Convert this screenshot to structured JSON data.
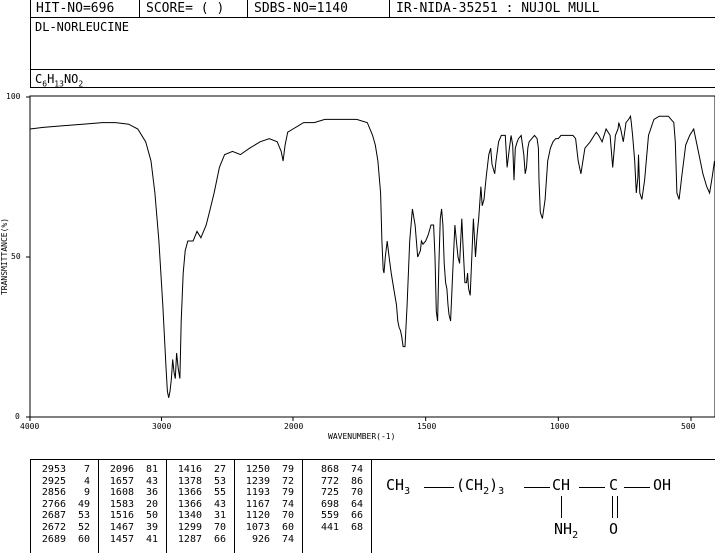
{
  "header": {
    "hit": "HIT-NO=696",
    "score": "SCORE=  (   )",
    "sdbs": "SDBS-NO=1140",
    "ir": "IR-NIDA-35251 : NUJOL MULL"
  },
  "compound": {
    "name": "DL-NORLEUCINE",
    "formula_parts": [
      "C",
      "6",
      "H",
      "13",
      "NO",
      "2"
    ]
  },
  "chart_data": {
    "type": "line",
    "title": "",
    "xlabel": "WAVENUMBER(-1)",
    "ylabel": "TRANSMITTANCE(%)",
    "xlim": [
      4000,
      400
    ],
    "ylim": [
      0,
      100
    ],
    "xticks": [
      "4000",
      "3000",
      "2000",
      "1500",
      "1000",
      "500"
    ],
    "yticks": [
      "100",
      "50",
      "0"
    ],
    "x_scale": "piecewise: 4000-2000 compressed, 2000-400 expanded",
    "series": [
      {
        "x": [
          4000,
          3900,
          3750,
          3600,
          3450,
          3350,
          3250,
          3180,
          3120,
          3080,
          3050,
          3020,
          2990,
          2965,
          2955,
          2945,
          2935,
          2925,
          2915,
          2905,
          2895,
          2885,
          2872,
          2860,
          2850,
          2835,
          2820,
          2800,
          2760,
          2730,
          2700,
          2660,
          2630,
          2600,
          2560,
          2520,
          2460,
          2400,
          2330,
          2250,
          2180,
          2120,
          2090,
          2075,
          2060,
          2040,
          2000,
          1960,
          1920,
          1880,
          1840,
          1800,
          1760,
          1720,
          1700,
          1690,
          1680,
          1670,
          1665,
          1660,
          1657,
          1652,
          1645,
          1638,
          1630,
          1620,
          1610,
          1605,
          1600,
          1595,
          1590,
          1585,
          1578,
          1570,
          1560,
          1550,
          1540,
          1530,
          1520,
          1516,
          1510,
          1500,
          1490,
          1480,
          1470,
          1465,
          1460,
          1455,
          1450,
          1445,
          1440,
          1435,
          1430,
          1425,
          1420,
          1416,
          1412,
          1406,
          1398,
          1390,
          1384,
          1378,
          1372,
          1368,
          1364,
          1360,
          1352,
          1346,
          1342,
          1340,
          1338,
          1332,
          1326,
          1320,
          1312,
          1306,
          1300,
          1292,
          1287,
          1280,
          1272,
          1262,
          1255,
          1250,
          1240,
          1235,
          1225,
          1215,
          1200,
          1193,
          1186,
          1178,
          1172,
          1167,
          1162,
          1155,
          1150,
          1140,
          1130,
          1125,
          1120,
          1115,
          1110,
          1100,
          1090,
          1080,
          1075,
          1073,
          1068,
          1060,
          1050,
          1040,
          1030,
          1020,
          1010,
          1000,
          990,
          980,
          970,
          960,
          945,
          935,
          925,
          915,
          900,
          880,
          865,
          857,
          848,
          835,
          820,
          805,
          795,
          785,
          775,
          772,
          765,
          755,
          745,
          735,
          728,
          725,
          720,
          712,
          706,
          700,
          698,
          693,
          685,
          675,
          660,
          640,
          620,
          600,
          585,
          575,
          565,
          559,
          553,
          545,
          535,
          520,
          505,
          490,
          470,
          455,
          441,
          430,
          420,
          400
        ],
        "y": [
          90,
          90.5,
          91,
          91.5,
          92,
          92,
          91.5,
          90,
          86,
          80,
          70,
          55,
          35,
          15,
          8,
          6,
          8,
          12,
          18,
          14,
          12,
          20,
          15,
          12,
          30,
          45,
          52,
          55,
          55,
          58,
          56,
          60,
          65,
          70,
          78,
          82,
          83,
          82,
          84,
          86,
          87,
          86,
          83,
          80,
          85,
          89,
          90,
          92,
          92,
          93,
          93,
          93,
          93,
          92,
          88,
          85,
          80,
          70,
          55,
          46,
          45,
          50,
          55,
          50,
          45,
          40,
          35,
          30,
          28,
          27,
          25,
          22,
          22,
          35,
          55,
          65,
          60,
          50,
          52,
          55,
          54,
          55,
          57,
          60,
          60,
          50,
          33,
          30,
          48,
          62,
          65,
          60,
          48,
          42,
          40,
          35,
          32,
          30,
          45,
          60,
          55,
          50,
          48,
          55,
          62,
          55,
          42,
          42,
          45,
          42,
          40,
          38,
          50,
          62,
          50,
          57,
          62,
          72,
          66,
          68,
          75,
          82,
          84,
          79,
          76,
          80,
          86,
          88,
          88,
          78,
          83,
          88,
          85,
          74,
          84,
          86,
          87,
          88,
          82,
          76,
          78,
          84,
          86,
          87,
          88,
          87,
          84,
          74,
          64,
          62,
          68,
          80,
          84,
          86,
          87,
          87,
          88,
          88,
          88,
          88,
          88,
          87,
          80,
          76,
          84,
          86,
          88,
          89,
          88,
          86,
          90,
          88,
          78,
          88,
          90,
          92,
          90,
          86,
          92,
          93,
          94,
          92,
          88,
          80,
          70,
          75,
          82,
          70,
          68,
          74,
          88,
          93,
          94,
          94,
          94,
          93,
          92,
          86,
          70,
          68,
          75,
          85,
          88,
          90,
          82,
          76,
          72,
          70,
          75,
          80
        ]
      }
    ]
  },
  "peaks": [
    [
      "2953",
      "7"
    ],
    [
      "2925",
      "4"
    ],
    [
      "2856",
      "9"
    ],
    [
      "2766",
      "49"
    ],
    [
      "2687",
      "53"
    ],
    [
      "2672",
      "52"
    ],
    [
      "2689",
      "60"
    ],
    [
      "2096",
      "81"
    ],
    [
      "1657",
      "43"
    ],
    [
      "1608",
      "36"
    ],
    [
      "1583",
      "20"
    ],
    [
      "1516",
      "50"
    ],
    [
      "1467",
      "39"
    ],
    [
      "1457",
      "41"
    ],
    [
      "1416",
      "27"
    ],
    [
      "1378",
      "53"
    ],
    [
      "1366",
      "55"
    ],
    [
      "1366",
      "43"
    ],
    [
      "1340",
      "31"
    ],
    [
      "1299",
      "70"
    ],
    [
      "1287",
      "66"
    ],
    [
      "1250",
      "79"
    ],
    [
      "1239",
      "72"
    ],
    [
      "1193",
      "79"
    ],
    [
      "1167",
      "74"
    ],
    [
      "1120",
      "70"
    ],
    [
      "1073",
      "60"
    ],
    [
      "926",
      "74"
    ],
    [
      "868",
      "74"
    ],
    [
      "772",
      "86"
    ],
    [
      "725",
      "70"
    ],
    [
      "698",
      "64"
    ],
    [
      "559",
      "66"
    ],
    [
      "441",
      "68"
    ]
  ],
  "structure": {
    "ch3": "CH",
    "ch3_sub": "3",
    "ch2_open": "(CH",
    "ch2_sub": "2",
    "ch2_close": ")",
    "ch2_count": "3",
    "ch": "CH",
    "c": "C",
    "oh": "OH",
    "nh2": "NH",
    "nh2_sub": "2",
    "o": "O"
  }
}
